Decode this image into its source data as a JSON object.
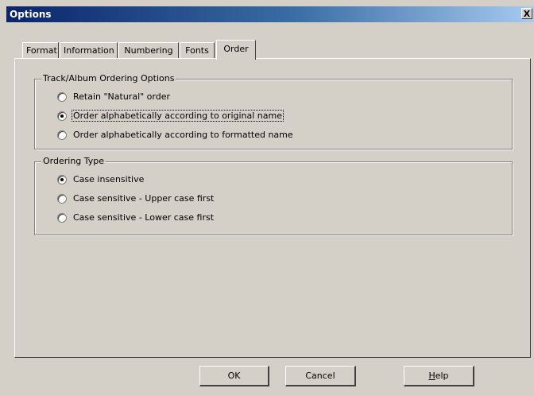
{
  "window": {
    "title": "Options",
    "close_glyph": "X"
  },
  "tabs": [
    {
      "label": "Format"
    },
    {
      "label": "Information"
    },
    {
      "label": "Numbering"
    },
    {
      "label": "Fonts"
    },
    {
      "label": "Order",
      "selected": true
    }
  ],
  "track_album_group": {
    "label": "Track/Album Ordering Options",
    "options": [
      {
        "label": "Retain \"Natural\" order",
        "checked": false
      },
      {
        "label": "Order alphabetically according to original name",
        "checked": true
      },
      {
        "label": "Order alphabetically according to formatted name",
        "checked": false
      }
    ]
  },
  "ordering_type_group": {
    "label": "Ordering Type",
    "options": [
      {
        "label": "Case insensitive",
        "checked": true
      },
      {
        "label": "Case sensitive - Upper case first",
        "checked": false
      },
      {
        "label": "Case sensitive - Lower case first",
        "checked": false
      }
    ]
  },
  "buttons": {
    "ok": "OK",
    "cancel": "Cancel",
    "help_first": "H",
    "help_rest": "elp"
  }
}
